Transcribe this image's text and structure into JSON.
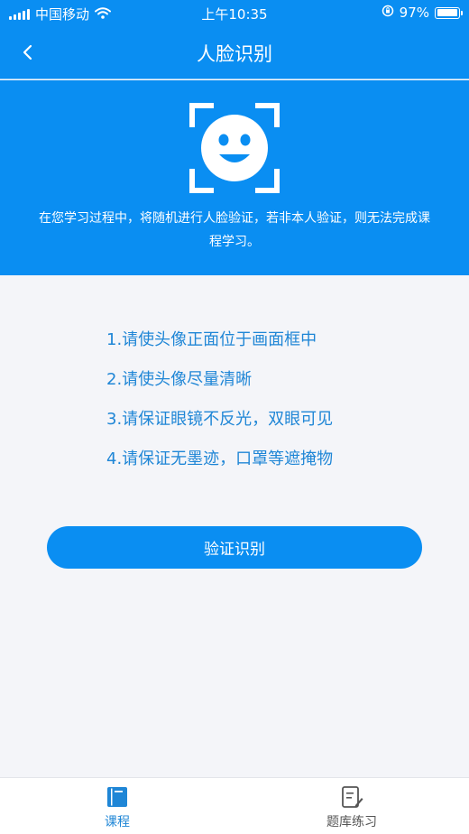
{
  "status_bar": {
    "carrier": "中国移动",
    "time": "上午10:35",
    "battery_percent": "97%",
    "battery_level": 0.97,
    "icons": [
      "signal-icon",
      "wifi-icon",
      "orientation-lock-icon",
      "battery-icon"
    ]
  },
  "nav": {
    "title": "人脸识别",
    "back_icon": "chevron-left-icon"
  },
  "hero": {
    "icon": "face-scan-icon",
    "description": "在您学习过程中，将随机进行人脸验证，若非本人验证，则无法完成课程学习。"
  },
  "tips": [
    "1.请使头像正面位于画面框中",
    "2.请使头像尽量清晰",
    "3.请保证眼镜不反光，双眼可见",
    "4.请保证无墨迹，口罩等遮掩物"
  ],
  "verify_button": {
    "label": "验证识别"
  },
  "tab_bar": {
    "tabs": [
      {
        "label": "课程",
        "icon": "book-icon",
        "active": true
      },
      {
        "label": "题库练习",
        "icon": "practice-icon",
        "active": false
      }
    ]
  },
  "colors": {
    "primary": "#0a8ef2",
    "tip_text": "#1f86d6",
    "background": "#f4f5f9"
  }
}
